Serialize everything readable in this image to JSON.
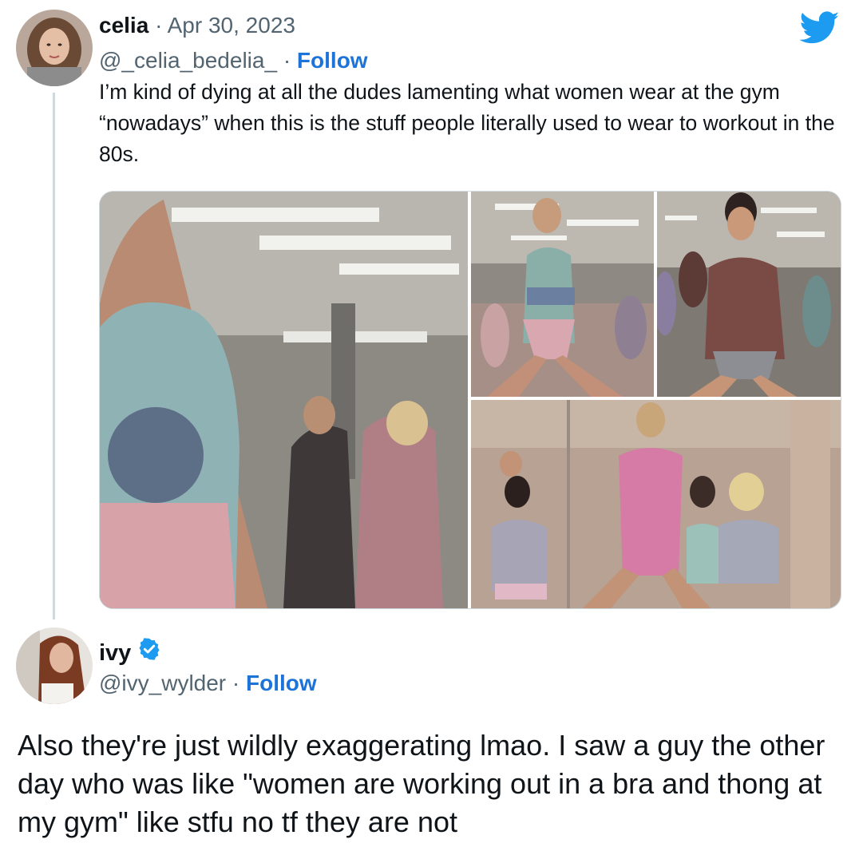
{
  "tweet": {
    "author_name": "celia",
    "separator": "·",
    "date": "Apr 30, 2023",
    "handle": "@_celia_bedelia_",
    "follow_label": "Follow",
    "text": "I’m kind of dying at all the dudes lamenting what women wear at the gym “nowadays” when this is the stuff people literally used to wear to workout in the 80s.",
    "media_count": 4
  },
  "reply": {
    "author_name": "ivy",
    "verified": true,
    "handle": "@ivy_wylder",
    "separator": "·",
    "follow_label": "Follow",
    "text": "Also they're just wildly exaggerating lmao. I saw a guy the other day who was like \"women are working out in a bra and thong at my gym\" like stfu no tf they are not"
  },
  "icons": {
    "brand": "twitter-bird-icon",
    "verified": "verified-badge-icon"
  },
  "colors": {
    "follow": "#1d74d8",
    "twitter_blue": "#1d9bf0",
    "muted": "#536471",
    "thread_line": "#cfd9de"
  }
}
